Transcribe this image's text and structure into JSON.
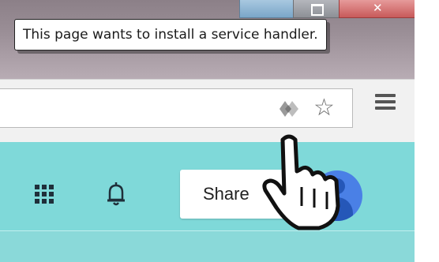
{
  "window": {
    "controls": [
      "minimize",
      "maximize",
      "close"
    ]
  },
  "tooltip": {
    "text": "This page wants to install a service handler."
  },
  "toolbar": {
    "icons": [
      "service-handler-icon",
      "star-icon",
      "menu-icon"
    ]
  },
  "app_bar": {
    "share_label": "Share",
    "icons": [
      "apps-grid-icon",
      "notifications-bell-icon",
      "avatar"
    ],
    "background": "#7fd9d9"
  }
}
